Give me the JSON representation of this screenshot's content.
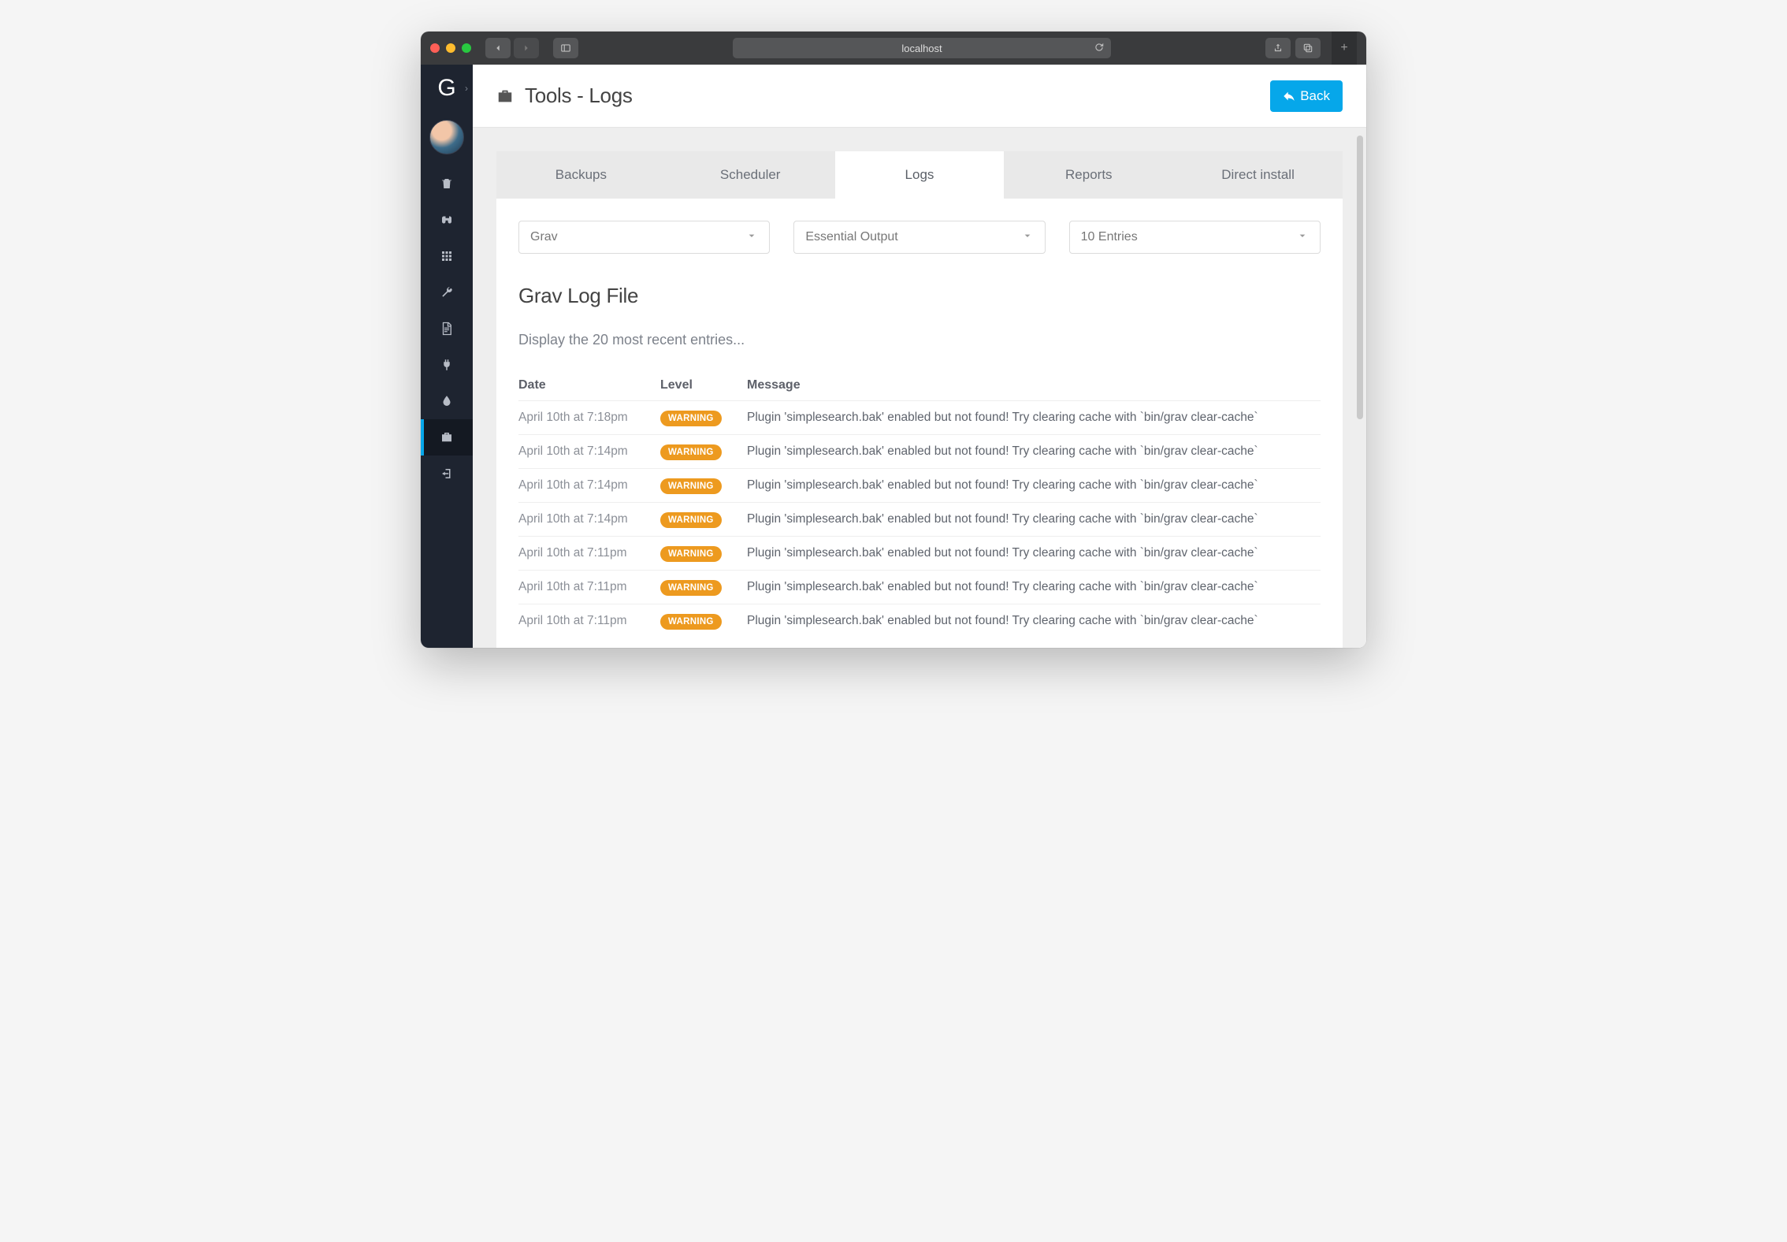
{
  "browser": {
    "url": "localhost"
  },
  "header": {
    "title": "Tools - Logs",
    "back_label": "Back"
  },
  "tabs": [
    {
      "label": "Backups",
      "active": false
    },
    {
      "label": "Scheduler",
      "active": false
    },
    {
      "label": "Logs",
      "active": true
    },
    {
      "label": "Reports",
      "active": false
    },
    {
      "label": "Direct install",
      "active": false
    }
  ],
  "filters": {
    "source": "Grav",
    "level": "Essential Output",
    "count": "10 Entries"
  },
  "section": {
    "heading": "Grav Log File",
    "subtitle": "Display the 20 most recent entries..."
  },
  "columns": {
    "date": "Date",
    "level": "Level",
    "message": "Message"
  },
  "logs": [
    {
      "date": "April 10th at 7:18pm",
      "level": "WARNING",
      "message": "Plugin 'simplesearch.bak' enabled but not found! Try clearing cache with `bin/grav clear-cache`"
    },
    {
      "date": "April 10th at 7:14pm",
      "level": "WARNING",
      "message": "Plugin 'simplesearch.bak' enabled but not found! Try clearing cache with `bin/grav clear-cache`"
    },
    {
      "date": "April 10th at 7:14pm",
      "level": "WARNING",
      "message": "Plugin 'simplesearch.bak' enabled but not found! Try clearing cache with `bin/grav clear-cache`"
    },
    {
      "date": "April 10th at 7:14pm",
      "level": "WARNING",
      "message": "Plugin 'simplesearch.bak' enabled but not found! Try clearing cache with `bin/grav clear-cache`"
    },
    {
      "date": "April 10th at 7:11pm",
      "level": "WARNING",
      "message": "Plugin 'simplesearch.bak' enabled but not found! Try clearing cache with `bin/grav clear-cache`"
    },
    {
      "date": "April 10th at 7:11pm",
      "level": "WARNING",
      "message": "Plugin 'simplesearch.bak' enabled but not found! Try clearing cache with `bin/grav clear-cache`"
    },
    {
      "date": "April 10th at 7:11pm",
      "level": "WARNING",
      "message": "Plugin 'simplesearch.bak' enabled but not found! Try clearing cache with `bin/grav clear-cache`"
    }
  ]
}
